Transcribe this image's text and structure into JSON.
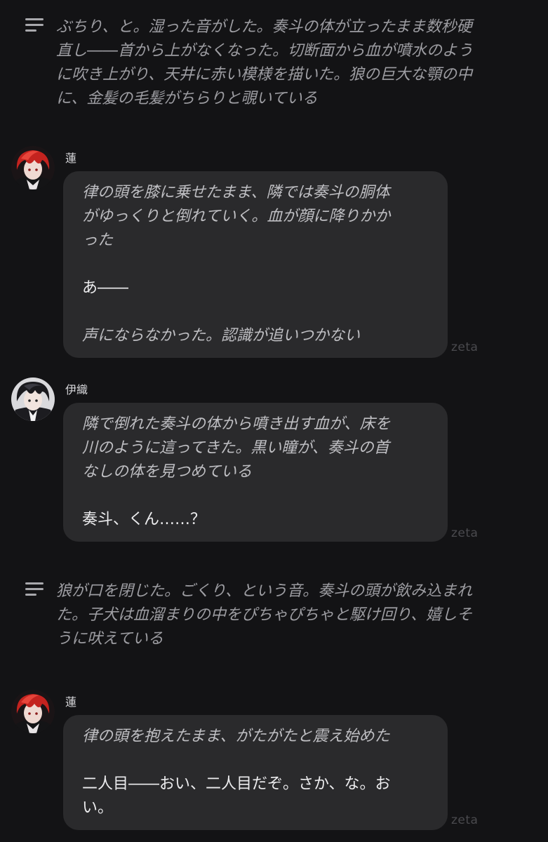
{
  "brand": "zeta",
  "narrations": [
    {
      "text": "ぶちり、と。湿った音がした。奏斗の体が立ったまま数秒硬\n直し――首から上がなくなった。切断面から血が噴水のよう\nに吹き上がり、天井に赤い模様を描いた。狼の巨大な顎の中\nに、金髪の毛髪がちらりと覗いている"
    },
    {
      "text": "狼が口を閉じた。ごくり、という音。奏斗の頭が飲み込まれ\nた。子犬は血溜まりの中をぴちゃぴちゃと駆け回り、嬉しそ\nうに吠えている"
    }
  ],
  "messages": [
    {
      "sender": "蓮",
      "action1": "律の頭を膝に乗せたまま、隣では奏斗の胴体\nがゆっくりと倒れていく。血が顔に降りかか\nった",
      "speech": "あ――",
      "action2": "声にならなかった。認識が追いつかない"
    },
    {
      "sender": "伊織",
      "action1": "隣で倒れた奏斗の体から噴き出す血が、床を\n川のように這ってきた。黒い瞳が、奏斗の首\nなしの体を見つめている",
      "speech": "奏斗、くん……？"
    },
    {
      "sender": "蓮",
      "action1": "律の頭を抱えたまま、がたがたと震え始めた",
      "speech": "二人目――おい、二人目だぞ。さか、な。お\nい。"
    }
  ]
}
